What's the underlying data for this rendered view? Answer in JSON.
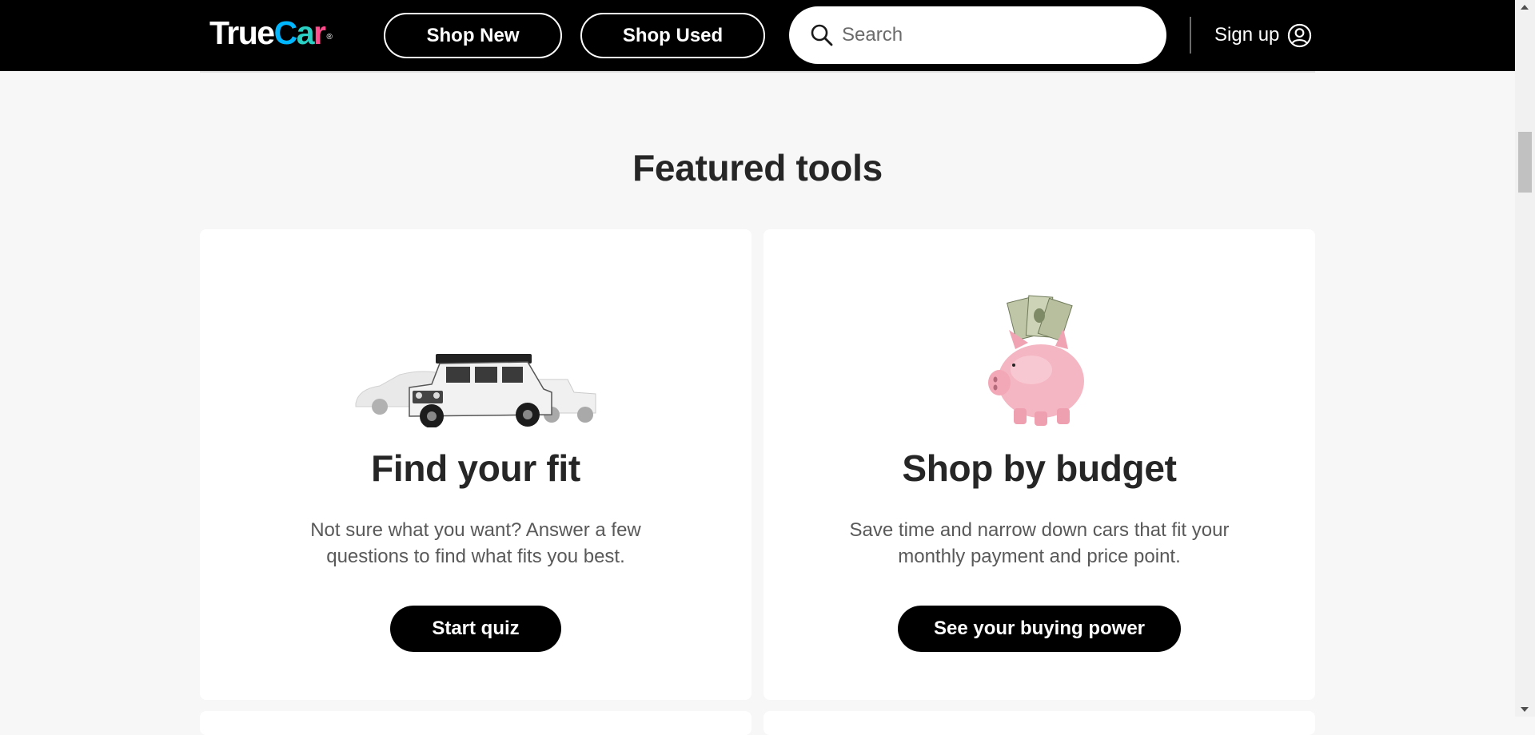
{
  "header": {
    "logo": {
      "part1": "True",
      "c1": "C",
      "c2": "a",
      "c3": "r",
      "reg": "®"
    },
    "shop_new_label": "Shop New",
    "shop_used_label": "Shop Used",
    "search_placeholder": "Search",
    "signup_label": "Sign up"
  },
  "section": {
    "title": "Featured tools"
  },
  "cards": [
    {
      "image": "cars-lineup-image",
      "title": "Find your fit",
      "description": "Not sure what you want? Answer a few questions to find what fits you best.",
      "button_label": "Start quiz"
    },
    {
      "image": "piggy-bank-image",
      "title": "Shop by budget",
      "description": "Save time and narrow down cars that fit your monthly payment and price point.",
      "button_label": "See your buying power"
    }
  ],
  "colors": {
    "header_bg": "#000000",
    "page_bg": "#f7f7f7",
    "card_bg": "#ffffff",
    "button_bg": "#000000",
    "logo_accents": [
      "#00b6ff",
      "#2bd0c4",
      "#ff4d8d",
      "#ffae00"
    ]
  }
}
